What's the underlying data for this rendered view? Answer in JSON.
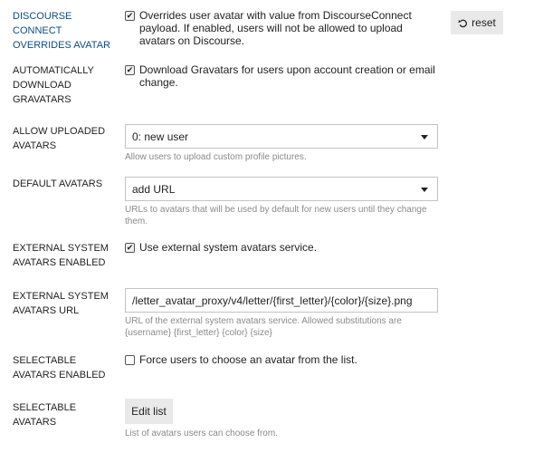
{
  "settings": {
    "discourse_connect": {
      "label": "DISCOURSE CONNECT OVERRIDES AVATAR",
      "checkbox_text": "Overrides user avatar with value from DiscourseConnect payload. If enabled, users will not be allowed to upload avatars on Discourse.",
      "checked": true,
      "reset_label": "reset"
    },
    "gravatars": {
      "label": "AUTOMATICALLY DOWNLOAD GRAVATARS",
      "checkbox_text": "Download Gravatars for users upon account creation or email change.",
      "checked": true
    },
    "uploaded_avatars": {
      "label": "ALLOW UPLOADED AVATARS",
      "selected": "0: new user",
      "description": "Allow users to upload custom profile pictures."
    },
    "default_avatars": {
      "label": "DEFAULT AVATARS",
      "selected": "add URL",
      "description": "URLs to avatars that will be used by default for new users until they change them."
    },
    "external_enabled": {
      "label": "EXTERNAL SYSTEM AVATARS ENABLED",
      "checkbox_text": "Use external system avatars service.",
      "checked": true
    },
    "external_url": {
      "label": "EXTERNAL SYSTEM AVATARS URL",
      "value": "/letter_avatar_proxy/v4/letter/{first_letter}/{color}/{size}.png",
      "description": "URL of the external system avatars service. Allowed substitutions are {username} {first_letter} {color} {size}"
    },
    "selectable_enabled": {
      "label": "SELECTABLE AVATARS ENABLED",
      "checkbox_text": "Force users to choose an avatar from the list.",
      "checked": false
    },
    "selectable_avatars": {
      "label": "SELECTABLE AVATARS",
      "button_label": "Edit list",
      "description": "List of avatars users can choose from."
    }
  },
  "check_mark": "✔",
  "icons": {
    "reset": "undo-icon",
    "dropdown": "caret-down-icon"
  },
  "colors": {
    "accent_label": "#0f4c85",
    "description": "#8a8a8a",
    "button_bg": "#e9e9e9"
  }
}
